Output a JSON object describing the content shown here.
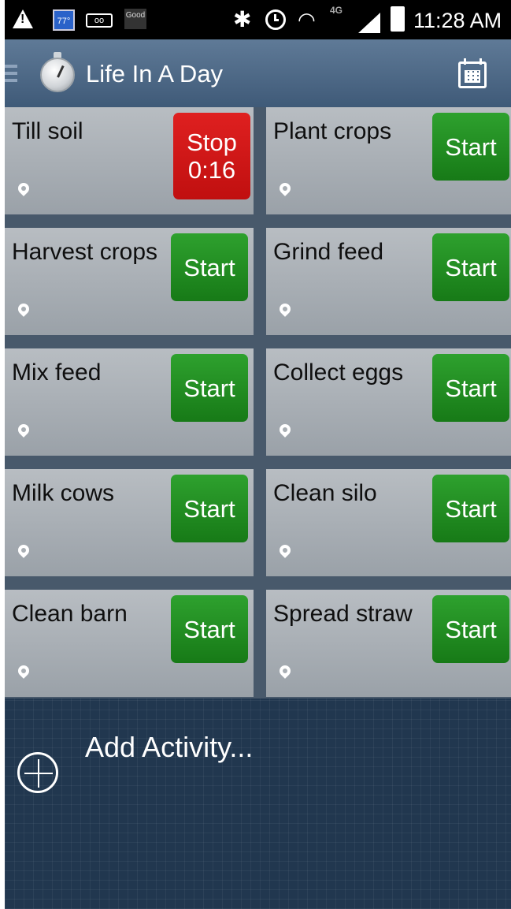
{
  "status_bar": {
    "weather_temp": "77°",
    "quality_label": "Good",
    "network_label": "4G",
    "time": "11:28 AM"
  },
  "app": {
    "title": "Life In A Day"
  },
  "activities": [
    {
      "name": "Till soil",
      "button": {
        "label": "Stop",
        "timer": "0:16",
        "state": "running"
      }
    },
    {
      "name": "Plant crops",
      "button": {
        "label": "Start",
        "state": "idle"
      }
    },
    {
      "name": "Harvest crops",
      "button": {
        "label": "Start",
        "state": "idle"
      }
    },
    {
      "name": "Grind feed",
      "button": {
        "label": "Start",
        "state": "idle"
      }
    },
    {
      "name": "Mix feed",
      "button": {
        "label": "Start",
        "state": "idle"
      }
    },
    {
      "name": "Collect eggs",
      "button": {
        "label": "Start",
        "state": "idle"
      }
    },
    {
      "name": "Milk cows",
      "button": {
        "label": "Start",
        "state": "idle"
      }
    },
    {
      "name": "Clean silo",
      "button": {
        "label": "Start",
        "state": "idle"
      }
    },
    {
      "name": "Clean barn",
      "button": {
        "label": "Start",
        "state": "idle"
      }
    },
    {
      "name": "Spread straw",
      "button": {
        "label": "Start",
        "state": "idle"
      }
    }
  ],
  "add_activity": {
    "label": "Add Activity..."
  },
  "colors": {
    "start_green": "#1f8c1f",
    "stop_red": "#d01818",
    "action_bar": "#4d6785",
    "background": "#21374f"
  }
}
